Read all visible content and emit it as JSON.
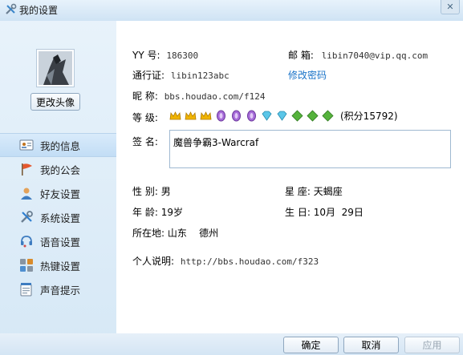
{
  "window": {
    "title": "我的设置",
    "close_symbol": "✕"
  },
  "sidebar": {
    "change_avatar": "更改头像",
    "items": [
      {
        "label": "我的信息",
        "icon": "id-card-icon",
        "active": true
      },
      {
        "label": "我的公会",
        "icon": "flag-icon",
        "active": false
      },
      {
        "label": "好友设置",
        "icon": "user-icon",
        "active": false
      },
      {
        "label": "系统设置",
        "icon": "tools-icon",
        "active": false
      },
      {
        "label": "语音设置",
        "icon": "headset-icon",
        "active": false
      },
      {
        "label": "热键设置",
        "icon": "keyboard-icon",
        "active": false
      },
      {
        "label": "声音提示",
        "icon": "notepad-icon",
        "active": false
      }
    ]
  },
  "profile": {
    "yy_label": "YY  号:",
    "yy_value": "186300",
    "email_label": "邮  箱:",
    "email_value": "libin7040@vip.qq.com",
    "passport_label": "通行证:",
    "passport_value": "libin123abc",
    "change_password": "修改密码",
    "nickname_label": "昵  称:",
    "nickname_value": "bbs.houdao.com/f124",
    "level_label": "等  级:",
    "score_text": "(积分15792)",
    "signature_label": "签  名:",
    "signature_value": "魔兽争霸3-Warcraf",
    "gender_label": "性  别:",
    "gender_value": "男",
    "zodiac_label": "星  座:",
    "zodiac_value": "天蝎座",
    "age_label": "年  龄:",
    "age_value": "19岁",
    "birthday_label": "生  日:",
    "birthday_value": "10月  29日",
    "location_label": "所在地:",
    "location_value": "山东    德州",
    "bio_label": "个人说明:",
    "bio_value": "http://bbs.houdao.com/f323"
  },
  "footer": {
    "ok": "确定",
    "cancel": "取消",
    "apply": "应用"
  },
  "colors": {
    "link": "#1a73c8",
    "active_bg": "#c2ddf5"
  }
}
